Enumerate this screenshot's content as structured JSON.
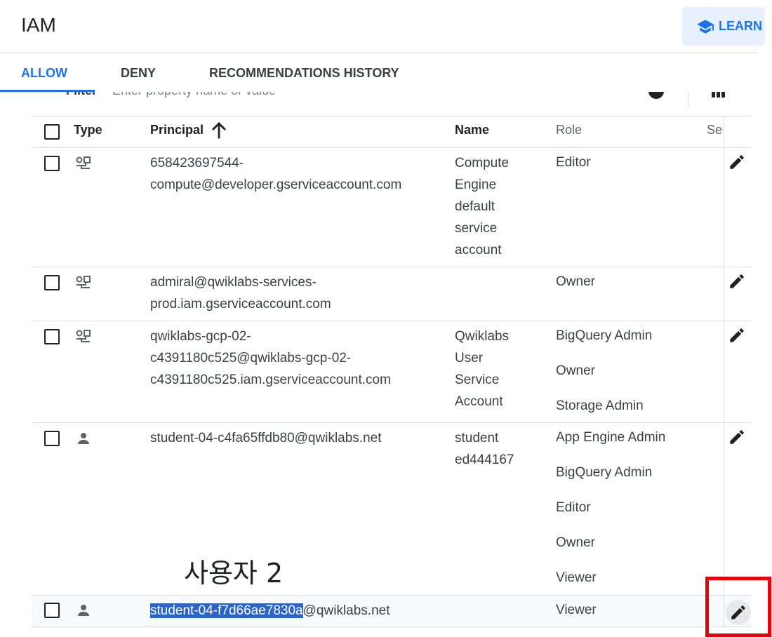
{
  "header": {
    "title": "IAM",
    "learn_label": "LEARN",
    "learn_icon": "school-icon"
  },
  "tabs": [
    {
      "label": "ALLOW",
      "active": true
    },
    {
      "label": "DENY",
      "active": false
    },
    {
      "label": "RECOMMENDATIONS HISTORY",
      "active": false
    }
  ],
  "filter": {
    "label": "Filter",
    "placeholder": "Enter property name or value",
    "help_icon": "help-icon",
    "columns_icon": "column-display-icon"
  },
  "table": {
    "columns": {
      "type": "Type",
      "principal": "Principal",
      "name": "Name",
      "role": "Role",
      "security": "Se"
    },
    "sort_icon": "arrow-up-icon",
    "rows": [
      {
        "type_icon": "service-account-icon",
        "principal": "658423697544-compute@developer.gserviceaccount.com",
        "principal_lines": [
          "658423697544-",
          "compute@developer.gserviceaccount.com"
        ],
        "name_lines": [
          "Compute",
          "Engine",
          "default",
          "service",
          "account"
        ],
        "roles": [
          "Editor"
        ]
      },
      {
        "type_icon": "service-account-icon",
        "principal": "admiral@qwiklabs-services-prod.iam.gserviceaccount.com",
        "principal_lines": [
          "admiral@qwiklabs-services-",
          "prod.iam.gserviceaccount.com"
        ],
        "name_lines": [],
        "roles": [
          "Owner"
        ]
      },
      {
        "type_icon": "service-account-icon",
        "principal": "qwiklabs-gcp-02-c4391180c525@qwiklabs-gcp-02-c4391180c525.iam.gserviceaccount.com",
        "principal_lines": [
          "qwiklabs-gcp-02-",
          "c4391180c525@qwiklabs-gcp-02-",
          "c4391180c525.iam.gserviceaccount.com"
        ],
        "name_lines": [
          "Qwiklabs",
          "User",
          "Service",
          "Account"
        ],
        "roles": [
          "BigQuery Admin",
          "Owner",
          "Storage Admin"
        ]
      },
      {
        "type_icon": "person-icon",
        "principal": "student-04-c4fa65ffdb80@qwiklabs.net",
        "principal_lines": [
          "student-04-c4fa65ffdb80@qwiklabs.net"
        ],
        "name_lines": [
          "student",
          "ed444167"
        ],
        "roles": [
          "App Engine Admin",
          "BigQuery Admin",
          "Editor",
          "Owner",
          "Viewer"
        ]
      },
      {
        "type_icon": "person-icon",
        "principal_highlight": "student-04-f7d66ae7830a",
        "principal_rest": "@qwiklabs.net",
        "name_lines": [],
        "roles": [
          "Viewer"
        ]
      }
    ],
    "edit_icon": "pencil-icon"
  },
  "annotation": {
    "text": "사용자 2",
    "box_color": "#e8000b"
  },
  "colors": {
    "accent": "#1a73e8",
    "selection": "#2a64c9"
  }
}
